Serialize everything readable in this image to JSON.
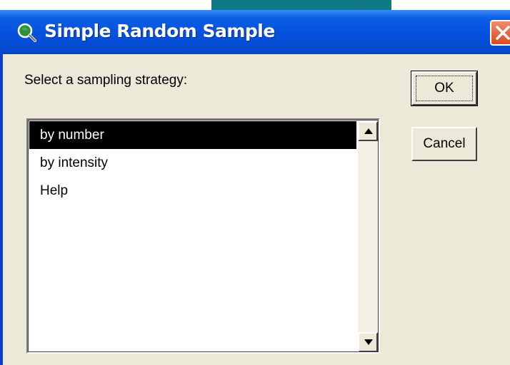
{
  "window": {
    "title": "Simple Random Sample",
    "icon": "magnifier-globe-icon",
    "close_icon": "close-icon"
  },
  "dialog": {
    "prompt": "Select a sampling strategy:",
    "options": [
      "by number",
      "by intensity",
      "Help"
    ],
    "selected_option": "by number"
  },
  "buttons": {
    "ok_label": "OK",
    "cancel_label": "Cancel"
  },
  "colors": {
    "titlebar": "#0551dd",
    "close_button": "#d94a22",
    "dialog_bg": "#ece9d8",
    "selection_bg": "#000000"
  }
}
